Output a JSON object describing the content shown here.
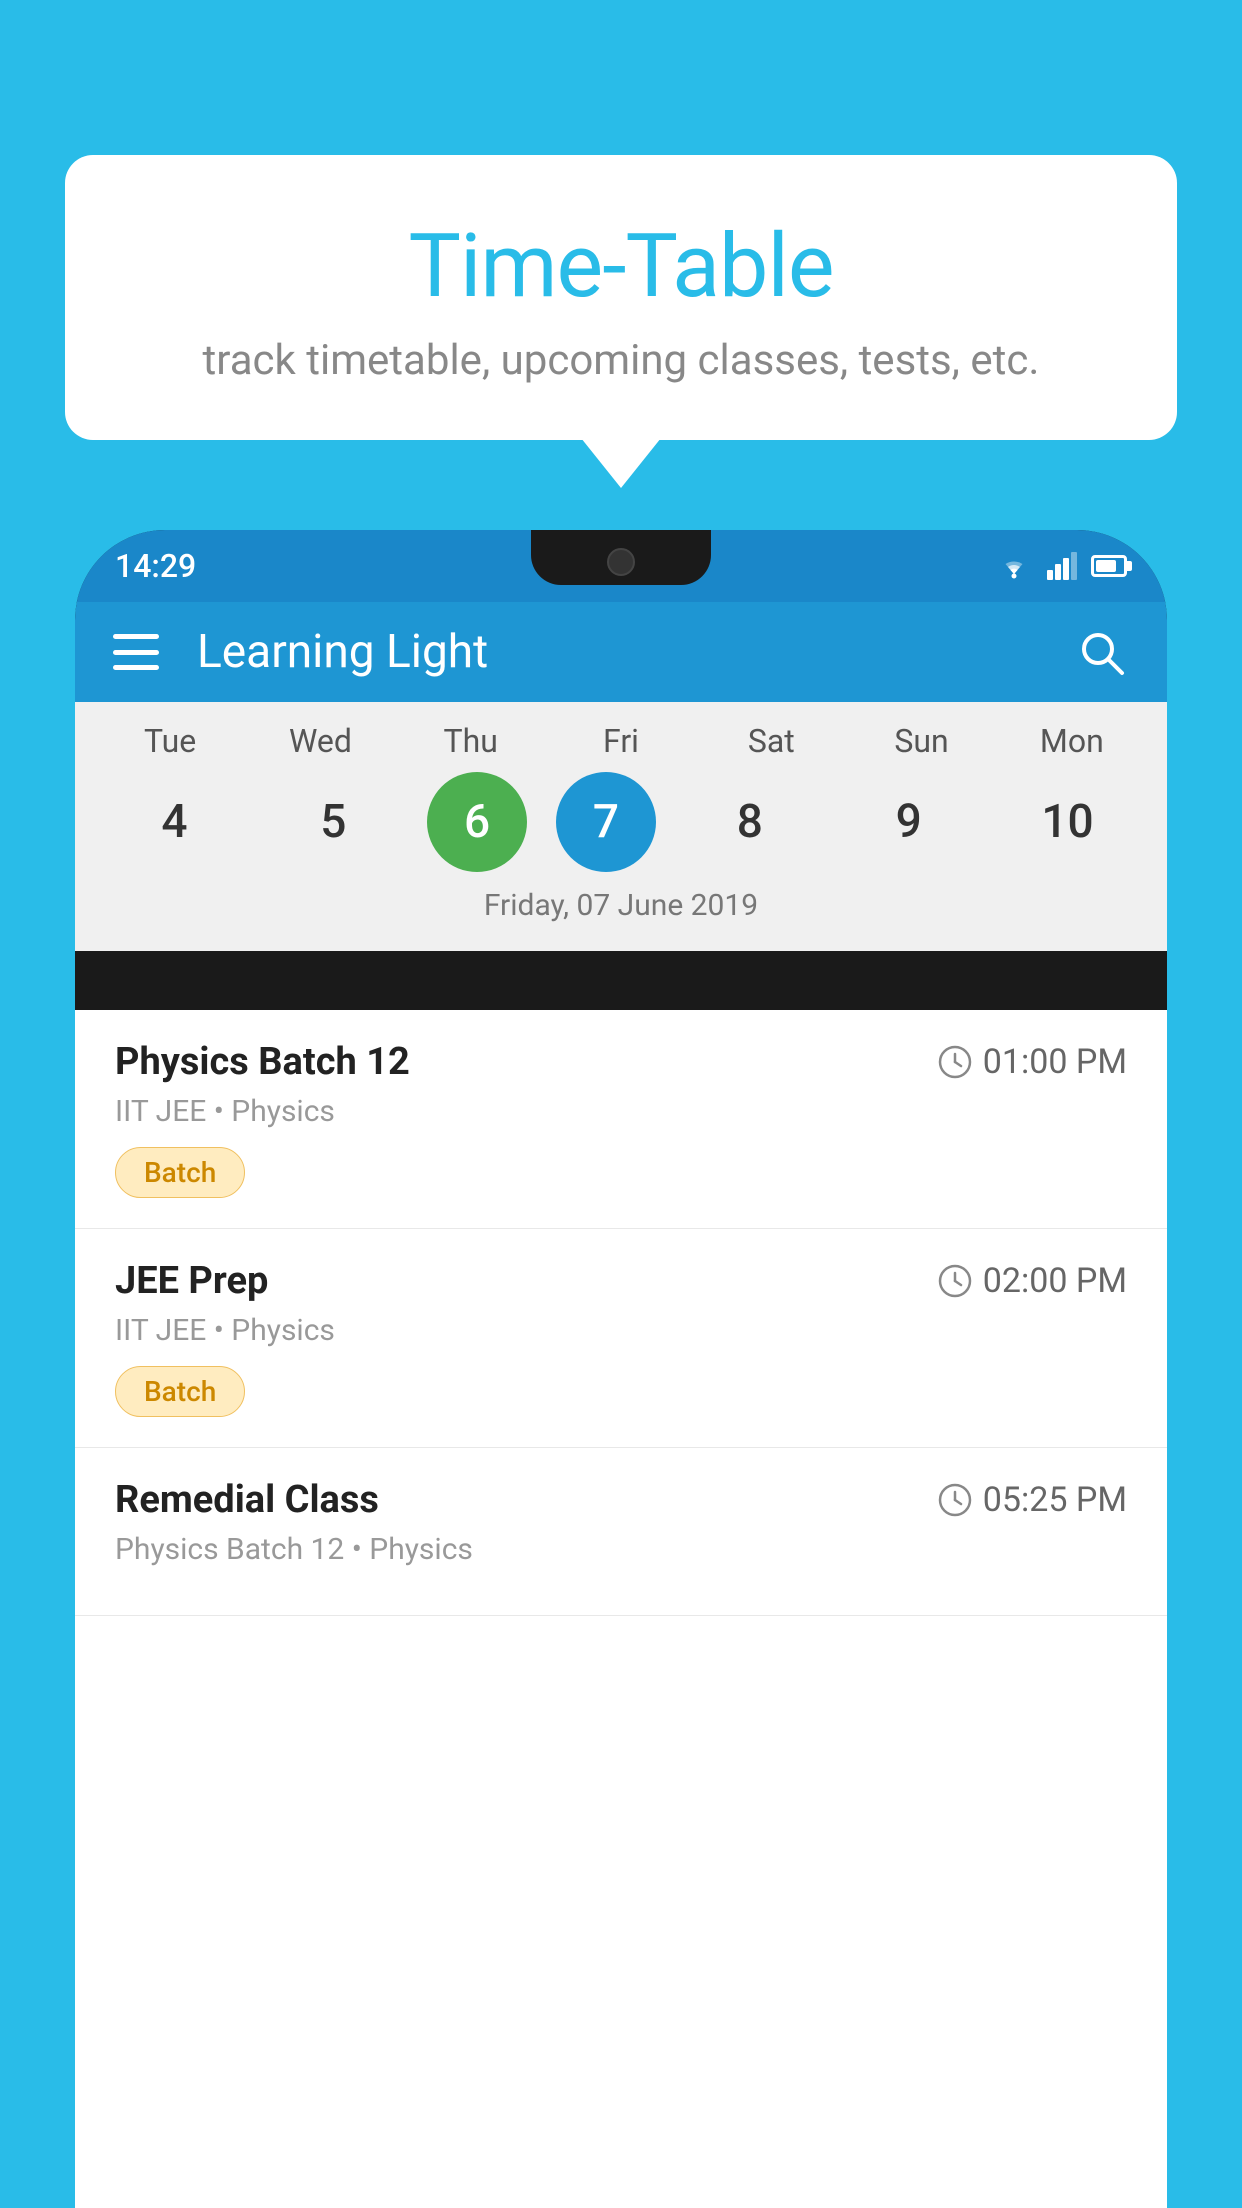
{
  "background_color": "#29bce8",
  "tooltip": {
    "title": "Time-Table",
    "subtitle": "track timetable, upcoming classes, tests, etc."
  },
  "phone": {
    "status_bar": {
      "time": "14:29"
    },
    "app_bar": {
      "title": "Learning Light"
    },
    "calendar": {
      "days": [
        {
          "name": "Tue",
          "num": "4",
          "state": "normal"
        },
        {
          "name": "Wed",
          "num": "5",
          "state": "normal"
        },
        {
          "name": "Thu",
          "num": "6",
          "state": "today"
        },
        {
          "name": "Fri",
          "num": "7",
          "state": "selected"
        },
        {
          "name": "Sat",
          "num": "8",
          "state": "normal"
        },
        {
          "name": "Sun",
          "num": "9",
          "state": "normal"
        },
        {
          "name": "Mon",
          "num": "10",
          "state": "normal"
        }
      ],
      "selected_date_label": "Friday, 07 June 2019"
    },
    "schedule": [
      {
        "title": "Physics Batch 12",
        "time": "01:00 PM",
        "subtitle": "IIT JEE • Physics",
        "badge": "Batch"
      },
      {
        "title": "JEE Prep",
        "time": "02:00 PM",
        "subtitle": "IIT JEE • Physics",
        "badge": "Batch"
      },
      {
        "title": "Remedial Class",
        "time": "05:25 PM",
        "subtitle": "Physics Batch 12 • Physics",
        "badge": null
      }
    ]
  }
}
